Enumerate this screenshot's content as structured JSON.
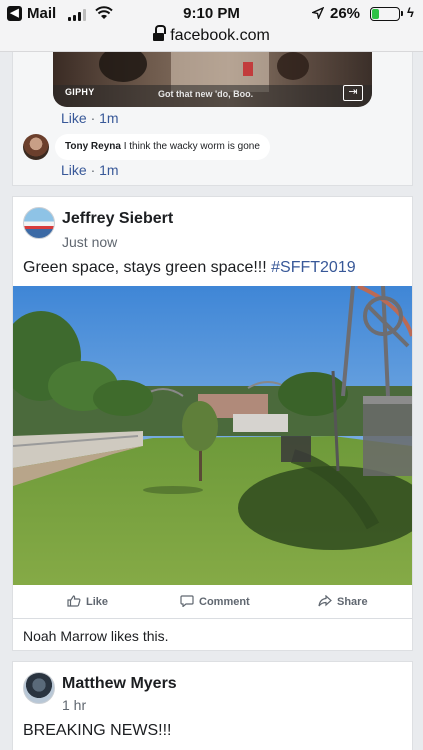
{
  "status_bar": {
    "back_app": "Mail",
    "time": "9:10 PM",
    "battery": "26%",
    "url": "facebook.com",
    "battery_level": 0.26
  },
  "prev_post": {
    "gif_source": "GIPHY",
    "gif_caption": "Got that new 'do, Boo.",
    "reaction1": {
      "like": "Like",
      "sep": " · ",
      "time": "1m"
    },
    "comment": {
      "author": "Tony Reyna",
      "text": "I think the wacky worm is gone"
    },
    "reaction2": {
      "like": "Like",
      "sep": " · ",
      "time": "1m"
    }
  },
  "post": {
    "author": "Jeffrey Siebert",
    "time": "Just now",
    "text": "Green space, stays green space!!! ",
    "hashtag": "#SFFT2019",
    "actions": {
      "like": "Like",
      "comment": "Comment",
      "share": "Share"
    },
    "likes_summary": "Noah Marrow likes this."
  },
  "next_post": {
    "author": "Matthew Myers",
    "time": "1 hr",
    "text": "BREAKING NEWS!!!"
  },
  "colors": {
    "link": "#385898",
    "secondary_text": "#606770",
    "background": "#e9ebee",
    "battery_fill": "#2ec245"
  }
}
